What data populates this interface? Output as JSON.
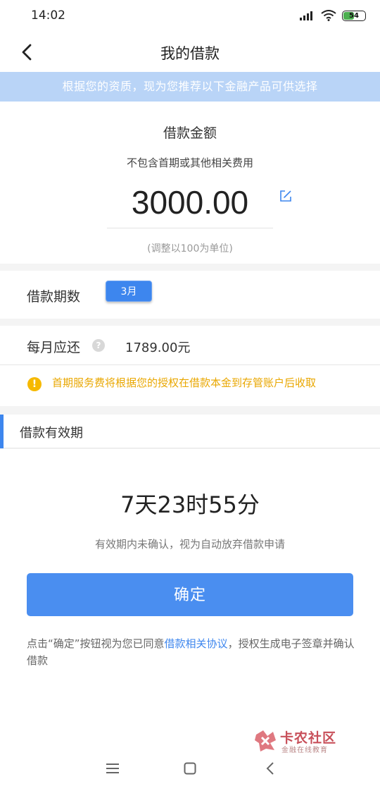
{
  "status_bar": {
    "time": "14:02",
    "battery": "54",
    "battery_level": 0.54
  },
  "nav": {
    "title": "我的借款"
  },
  "banner": {
    "text": "根据您的资质，现为您推荐以下金融产品可供选择"
  },
  "loan_amount": {
    "label": "借款金额",
    "subtitle": "不包含首期或其他相关费用",
    "value": "3000.00",
    "note": "(调整以100为单位)"
  },
  "term": {
    "label": "借款期数",
    "selected": "3月"
  },
  "monthly": {
    "label": "每月应还",
    "help": "?",
    "value": "1789.00元"
  },
  "notice": {
    "icon": "!",
    "text": "首期服务费将根据您的授权在借款本金到存管账户后收取"
  },
  "validity": {
    "title": "借款有效期",
    "countdown": "7天23时55分",
    "note": "有效期内未确认，视为自动放弃借款申请"
  },
  "confirm": {
    "label": "确定"
  },
  "agreement": {
    "prefix": "点击“确定”按钮视为您已同意",
    "link": "借款相关协议",
    "suffix": "，授权生成电子签章并确认借款"
  },
  "watermark": {
    "name": "卡农社区",
    "sub": "金融在线教育"
  },
  "colors": {
    "accent": "#3d86ee",
    "banner_bg": "#b9d4f7",
    "warning": "#e9a700",
    "button": "#4a8ef0"
  }
}
